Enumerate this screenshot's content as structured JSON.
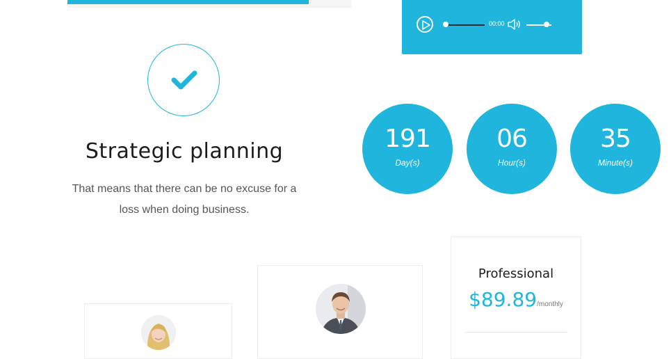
{
  "progress": {
    "fill_percent": 85
  },
  "audio_player": {
    "time": "00:00",
    "progress": 0,
    "volume": 0.8,
    "accent": "#1fb5dc"
  },
  "feature": {
    "icon": "check-icon",
    "title": "Strategic planning",
    "text_line1": "That means that there can be no excuse for a",
    "text_line2": "loss when doing business."
  },
  "countdown": [
    {
      "value": "191",
      "unit": "Day(s)"
    },
    {
      "value": "06",
      "unit": "Hour(s)"
    },
    {
      "value": "35",
      "unit": "Minute(s)"
    }
  ],
  "pricing": {
    "plan": "Professional",
    "price": "$89.89",
    "period": "/monthly"
  },
  "team": [
    {
      "avatar": "woman-avatar"
    },
    {
      "avatar": "man-avatar"
    }
  ],
  "colors": {
    "accent": "#1fb5dc",
    "text": "#1c1c1c",
    "muted": "#555555"
  }
}
